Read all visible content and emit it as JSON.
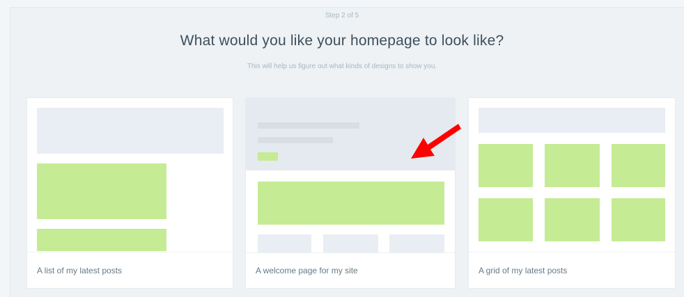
{
  "header": {
    "step": "Step 2 of 5",
    "title": "What would you like your homepage to look like?",
    "subtitle": "This will help us figure out what kinds of designs to show you."
  },
  "options": [
    {
      "label": "A list of my latest posts"
    },
    {
      "label": "A welcome page for my site"
    },
    {
      "label": "A grid of my latest posts"
    }
  ],
  "annotation": {
    "icon": "red-arrow-icon",
    "color": "#ff0000"
  },
  "colors": {
    "accent_green": "#c5eb94",
    "placeholder_grey": "#e8eef3"
  }
}
